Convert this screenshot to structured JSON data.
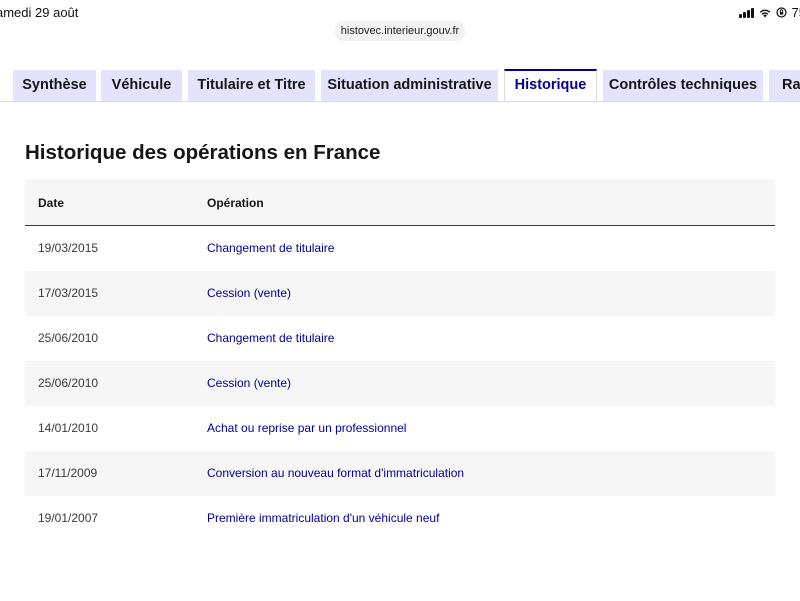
{
  "status_bar": {
    "date": "amedi 29 août",
    "battery": "75"
  },
  "browser": {
    "url": "histovec.interieur.gouv.fr"
  },
  "tabs": [
    {
      "label": "Synthèse",
      "active": false
    },
    {
      "label": "Véhicule",
      "active": false
    },
    {
      "label": "Titulaire et Titre",
      "active": false
    },
    {
      "label": "Situation administrative",
      "active": false
    },
    {
      "label": "Historique",
      "active": true
    },
    {
      "label": "Contrôles techniques",
      "active": false
    },
    {
      "label": "Rap",
      "active": false
    }
  ],
  "main": {
    "title": "Historique des opérations en France",
    "table": {
      "headers": [
        "Date",
        "Opération"
      ],
      "rows": [
        {
          "date": "19/03/2015",
          "operation": "Changement de titulaire"
        },
        {
          "date": "17/03/2015",
          "operation": "Cession (vente)"
        },
        {
          "date": "25/06/2010",
          "operation": "Changement de titulaire"
        },
        {
          "date": "25/06/2010",
          "operation": "Cession (vente)"
        },
        {
          "date": "14/01/2010",
          "operation": "Achat ou reprise par un professionnel"
        },
        {
          "date": "17/11/2009",
          "operation": "Conversion au nouveau format d'immatriculation"
        },
        {
          "date": "19/01/2007",
          "operation": "Première immatriculation d'un véhicule neuf"
        }
      ]
    }
  },
  "colors": {
    "accent": "#000091",
    "tab_bg": "#e3e3fd",
    "stripe": "#f6f6f6"
  }
}
